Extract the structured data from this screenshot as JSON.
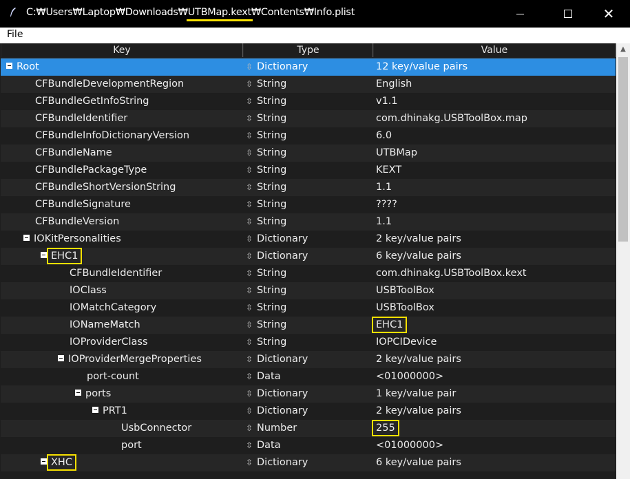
{
  "window": {
    "title_pre": "C:₩Users₩Laptop₩Downloads₩",
    "title_hl": "UTBMap.kext",
    "title_post": "₩Contents₩Info.plist"
  },
  "menu": {
    "file": "File"
  },
  "columns": {
    "key": "Key",
    "type": "Type",
    "value": "Value"
  },
  "rows": [
    {
      "key": "Root",
      "type": "Dictionary",
      "value": "12 key/value pairs",
      "level": 0,
      "expander": true,
      "selected": true
    },
    {
      "key": "CFBundleDevelopmentRegion",
      "type": "String",
      "value": "English",
      "level": 1
    },
    {
      "key": "CFBundleGetInfoString",
      "type": "String",
      "value": "v1.1",
      "level": 1
    },
    {
      "key": "CFBundleIdentifier",
      "type": "String",
      "value": "com.dhinakg.USBToolBox.map",
      "level": 1
    },
    {
      "key": "CFBundleInfoDictionaryVersion",
      "type": "String",
      "value": "6.0",
      "level": 1
    },
    {
      "key": "CFBundleName",
      "type": "String",
      "value": "UTBMap",
      "level": 1
    },
    {
      "key": "CFBundlePackageType",
      "type": "String",
      "value": "KEXT",
      "level": 1
    },
    {
      "key": "CFBundleShortVersionString",
      "type": "String",
      "value": "1.1",
      "level": 1
    },
    {
      "key": "CFBundleSignature",
      "type": "String",
      "value": "????",
      "level": 1
    },
    {
      "key": "CFBundleVersion",
      "type": "String",
      "value": "1.1",
      "level": 1
    },
    {
      "key": "IOKitPersonalities",
      "type": "Dictionary",
      "value": "2 key/value pairs",
      "level": 1,
      "expander": true
    },
    {
      "key": "EHC1",
      "type": "Dictionary",
      "value": "6 key/value pairs",
      "level": 2,
      "expander": true,
      "hl_key": true
    },
    {
      "key": "CFBundleIdentifier",
      "type": "String",
      "value": "com.dhinakg.USBToolBox.kext",
      "level": 3
    },
    {
      "key": "IOClass",
      "type": "String",
      "value": "USBToolBox",
      "level": 3
    },
    {
      "key": "IOMatchCategory",
      "type": "String",
      "value": "USBToolBox",
      "level": 3
    },
    {
      "key": "IONameMatch",
      "type": "String",
      "value": "EHC1",
      "level": 3,
      "hl_val": true
    },
    {
      "key": "IOProviderClass",
      "type": "String",
      "value": "IOPCIDevice",
      "level": 3
    },
    {
      "key": "IOProviderMergeProperties",
      "type": "Dictionary",
      "value": "2 key/value pairs",
      "level": 3,
      "expander": true
    },
    {
      "key": "port-count",
      "type": "Data",
      "value": "<01000000>",
      "level": 4
    },
    {
      "key": "ports",
      "type": "Dictionary",
      "value": "1 key/value pair",
      "level": 4,
      "expander": true
    },
    {
      "key": "PRT1",
      "type": "Dictionary",
      "value": "2 key/value pairs",
      "level": 5,
      "expander": true
    },
    {
      "key": "UsbConnector",
      "type": "Number",
      "value": "255",
      "level": 6,
      "hl_val": true
    },
    {
      "key": "port",
      "type": "Data",
      "value": "<01000000>",
      "level": 6
    },
    {
      "key": "XHC",
      "type": "Dictionary",
      "value": "6 key/value pairs",
      "level": 2,
      "expander": true,
      "hl_key": true
    }
  ]
}
